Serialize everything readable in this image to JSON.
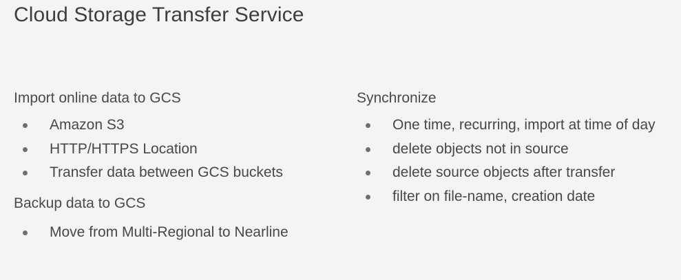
{
  "title": "Cloud Storage Transfer Service",
  "left": {
    "section1": {
      "heading": "Import online data to GCS",
      "items": [
        "Amazon S3",
        "HTTP/HTTPS Location",
        "Transfer data between GCS buckets"
      ]
    },
    "section2": {
      "heading": "Backup data to GCS",
      "items": [
        "Move from Multi-Regional to Nearline"
      ]
    }
  },
  "right": {
    "section1": {
      "heading": "Synchronize",
      "items": [
        "One time, recurring, import at time of day",
        "delete objects not in source",
        "delete source objects after transfer",
        "filter on file-name, creation date"
      ]
    }
  }
}
